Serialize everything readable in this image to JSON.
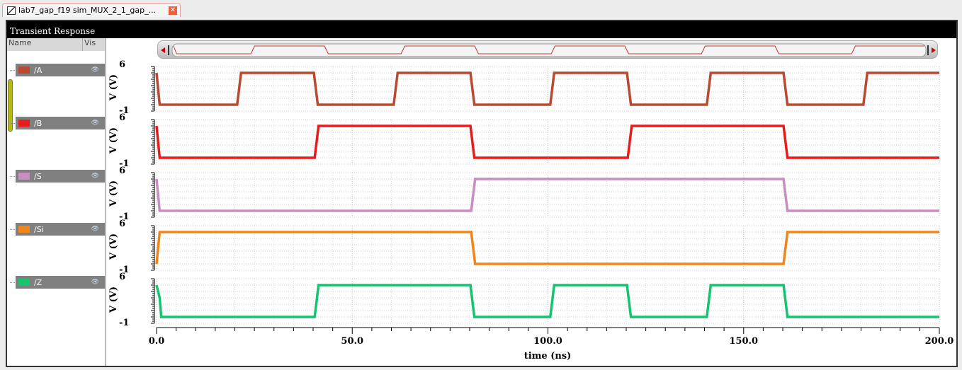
{
  "tab": {
    "title": "lab7_gap_f19 sim_MUX_2_1_gap_...",
    "close": "✕"
  },
  "window": {
    "title": "Transient Response"
  },
  "panel": {
    "name_header": "Name",
    "vis_header": "Vis",
    "eye": "👁"
  },
  "chart_data": {
    "type": "line",
    "xlabel": "time (ns)",
    "ylabel": "V (V)",
    "xlim": [
      0,
      200
    ],
    "ylim": [
      -1,
      6
    ],
    "xticks": [
      "0.0",
      "50.0",
      "100.0",
      "150.0",
      "200.0"
    ],
    "yticks": [
      "6",
      "-1"
    ],
    "grid": true,
    "series": [
      {
        "name": "/A",
        "color": "#b84a32",
        "points": [
          [
            0,
            5
          ],
          [
            0.8,
            0
          ],
          [
            20.6,
            0
          ],
          [
            21.6,
            5
          ],
          [
            40.2,
            5
          ],
          [
            41.2,
            0
          ],
          [
            60.6,
            0
          ],
          [
            61.6,
            5
          ],
          [
            80.2,
            5
          ],
          [
            81.2,
            0
          ],
          [
            100.6,
            0
          ],
          [
            101.6,
            5
          ],
          [
            120.2,
            5
          ],
          [
            121.2,
            0
          ],
          [
            140.6,
            0
          ],
          [
            141.6,
            5
          ],
          [
            160.2,
            5
          ],
          [
            161.2,
            0
          ],
          [
            180.6,
            0
          ],
          [
            181.6,
            5
          ],
          [
            200,
            5
          ]
        ]
      },
      {
        "name": "/B",
        "color": "#e81c1c",
        "points": [
          [
            0,
            5
          ],
          [
            0.8,
            0
          ],
          [
            40.4,
            0
          ],
          [
            41.4,
            5
          ],
          [
            80.2,
            5
          ],
          [
            81.2,
            0
          ],
          [
            120.4,
            0
          ],
          [
            121.4,
            5
          ],
          [
            160.2,
            5
          ],
          [
            161.2,
            0
          ],
          [
            200,
            0
          ]
        ]
      },
      {
        "name": "/S",
        "color": "#c98cc3",
        "points": [
          [
            0,
            5
          ],
          [
            0.8,
            0
          ],
          [
            80.4,
            0
          ],
          [
            81.4,
            5
          ],
          [
            160.2,
            5
          ],
          [
            161.2,
            0
          ],
          [
            200,
            0
          ]
        ]
      },
      {
        "name": "/Si",
        "color": "#f08519",
        "points": [
          [
            0,
            0
          ],
          [
            0.8,
            5
          ],
          [
            80.4,
            5
          ],
          [
            81.4,
            0
          ],
          [
            160.2,
            0
          ],
          [
            161.2,
            5
          ],
          [
            200,
            5
          ]
        ]
      },
      {
        "name": "/Z",
        "color": "#14c46e",
        "points": [
          [
            0,
            5
          ],
          [
            0.8,
            3
          ],
          [
            1.2,
            0
          ],
          [
            40.4,
            0
          ],
          [
            41.4,
            5
          ],
          [
            80.2,
            5
          ],
          [
            81.2,
            0
          ],
          [
            100.6,
            0
          ],
          [
            101.6,
            5
          ],
          [
            120.2,
            5
          ],
          [
            121.2,
            0
          ],
          [
            140.6,
            0
          ],
          [
            141.6,
            5
          ],
          [
            160.2,
            5
          ],
          [
            161.2,
            0
          ],
          [
            200,
            0
          ]
        ]
      }
    ]
  }
}
